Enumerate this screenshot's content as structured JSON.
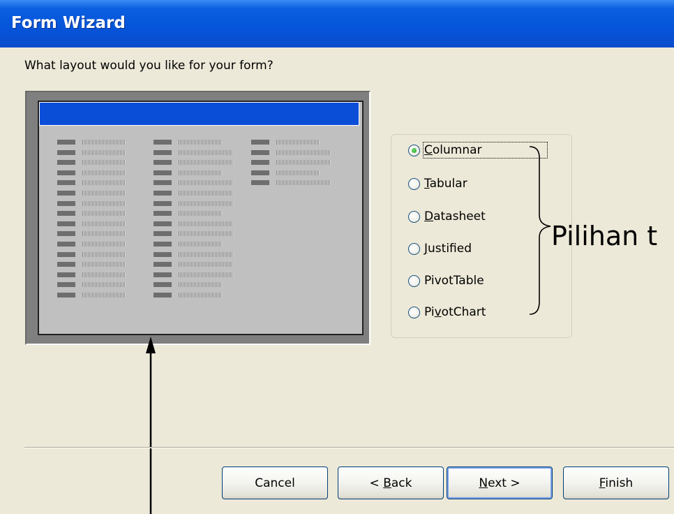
{
  "window": {
    "title": "Form Wizard"
  },
  "prompt": "What layout would you like for your form?",
  "layout_options": [
    {
      "label": "Columnar",
      "mnemonic": "C",
      "rest": "olumnar",
      "selected": true
    },
    {
      "label": "Tabular",
      "mnemonic": "T",
      "rest": "abular",
      "selected": false
    },
    {
      "label": "Datasheet",
      "mnemonic": "D",
      "rest": "atasheet",
      "selected": false
    },
    {
      "label": "Justified",
      "mnemonic": "J",
      "rest": "ustified",
      "selected": false
    },
    {
      "label": "PivotTable",
      "mnemonic": "",
      "rest": "PivotTable",
      "selected": false
    },
    {
      "label": "PivotChart",
      "pre": "Pi",
      "mnemonic": "v",
      "rest": "otChart",
      "selected": false
    }
  ],
  "annotation": {
    "text": "Pilihan t"
  },
  "buttons": {
    "cancel": {
      "label": "Cancel"
    },
    "back": {
      "pre": "< ",
      "mnemonic": "B",
      "rest": "ack"
    },
    "next": {
      "mnemonic": "N",
      "rest": "ext >"
    },
    "finish": {
      "mnemonic": "F",
      "rest": "inish"
    }
  },
  "colors": {
    "titlebar": "#0654d9",
    "dialog_bg": "#ece9d8",
    "preview_header": "#0a4ed8",
    "preview_bg": "#c0c0c0",
    "radio_selected": "#1f9a1f"
  }
}
